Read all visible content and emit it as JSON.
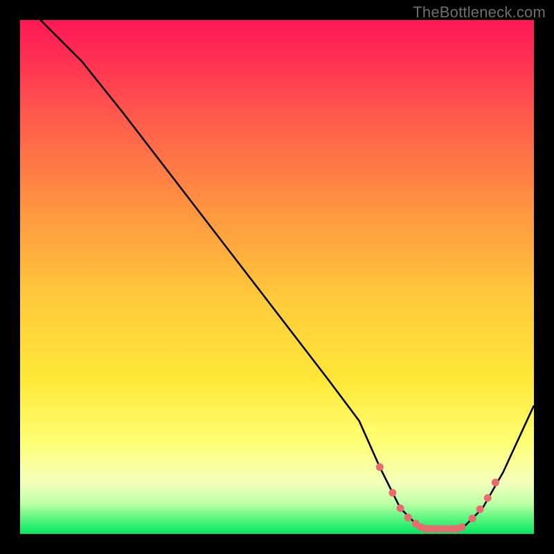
{
  "watermark": "TheBottleneck.com",
  "colors": {
    "black": "#000000",
    "line": "#000000",
    "marker": "#E86B6F",
    "gradient_top": "#FF1955",
    "gradient_mid": "#FFE738",
    "gradient_low": "#F4FFBB",
    "gradient_bottom": "#00E75C"
  },
  "chart_data": {
    "type": "line",
    "title": "",
    "xlabel": "",
    "ylabel": "",
    "xlim": [
      0,
      100
    ],
    "ylim": [
      0,
      100
    ],
    "grid": false,
    "legend": false,
    "series": [
      {
        "name": "curve",
        "x": [
          0,
          7,
          12,
          20,
          30,
          40,
          50,
          60,
          66,
          70,
          74,
          78,
          82,
          86,
          90,
          94,
          100
        ],
        "y": [
          104,
          97,
          92,
          82,
          69,
          56,
          43,
          30,
          22,
          13,
          5,
          1,
          1,
          1,
          5,
          12,
          25
        ]
      }
    ],
    "markers": {
      "name": "highlighted-points",
      "x": [
        70,
        72.5,
        74,
        75.5,
        77,
        78,
        79,
        80,
        81,
        82,
        83,
        84,
        85,
        86,
        88,
        89.5,
        91,
        92.5
      ],
      "y": [
        13,
        8,
        5,
        3.2,
        2,
        1.3,
        1,
        1,
        1,
        1,
        1,
        1,
        1,
        1.3,
        3,
        4.8,
        7,
        10
      ]
    }
  }
}
